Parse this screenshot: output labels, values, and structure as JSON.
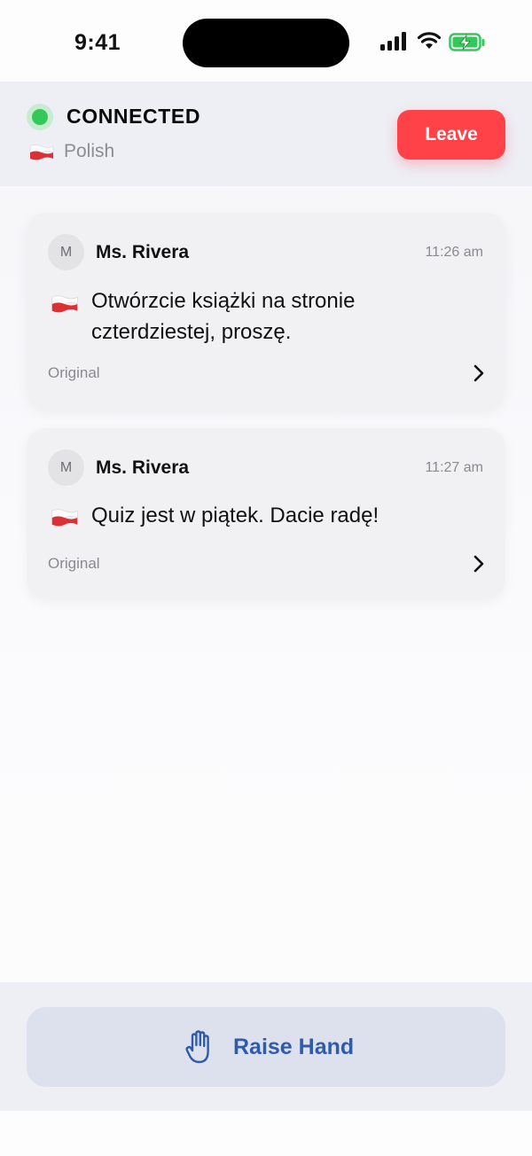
{
  "status_bar": {
    "time": "9:41"
  },
  "header": {
    "connection_status": "CONNECTED",
    "language": "Polish",
    "language_flag": "poland-flag-icon",
    "leave_label": "Leave",
    "status_color": "#34c759",
    "leave_color": "#ff4148"
  },
  "messages": [
    {
      "avatar_initial": "M",
      "sender": "Ms. Rivera",
      "time": "11:26 am",
      "flag": "poland-flag-icon",
      "text": "Otwórzcie książki na stronie czterdziestej, proszę.",
      "original_label": "Original"
    },
    {
      "avatar_initial": "M",
      "sender": "Ms. Rivera",
      "time": "11:27 am",
      "flag": "poland-flag-icon",
      "text": "Quiz jest w piątek. Dacie radę!",
      "original_label": "Original"
    }
  ],
  "footer": {
    "raise_hand_label": "Raise Hand",
    "raise_hand_icon": "raised-hand-icon",
    "accent_color": "#2f5bab"
  }
}
